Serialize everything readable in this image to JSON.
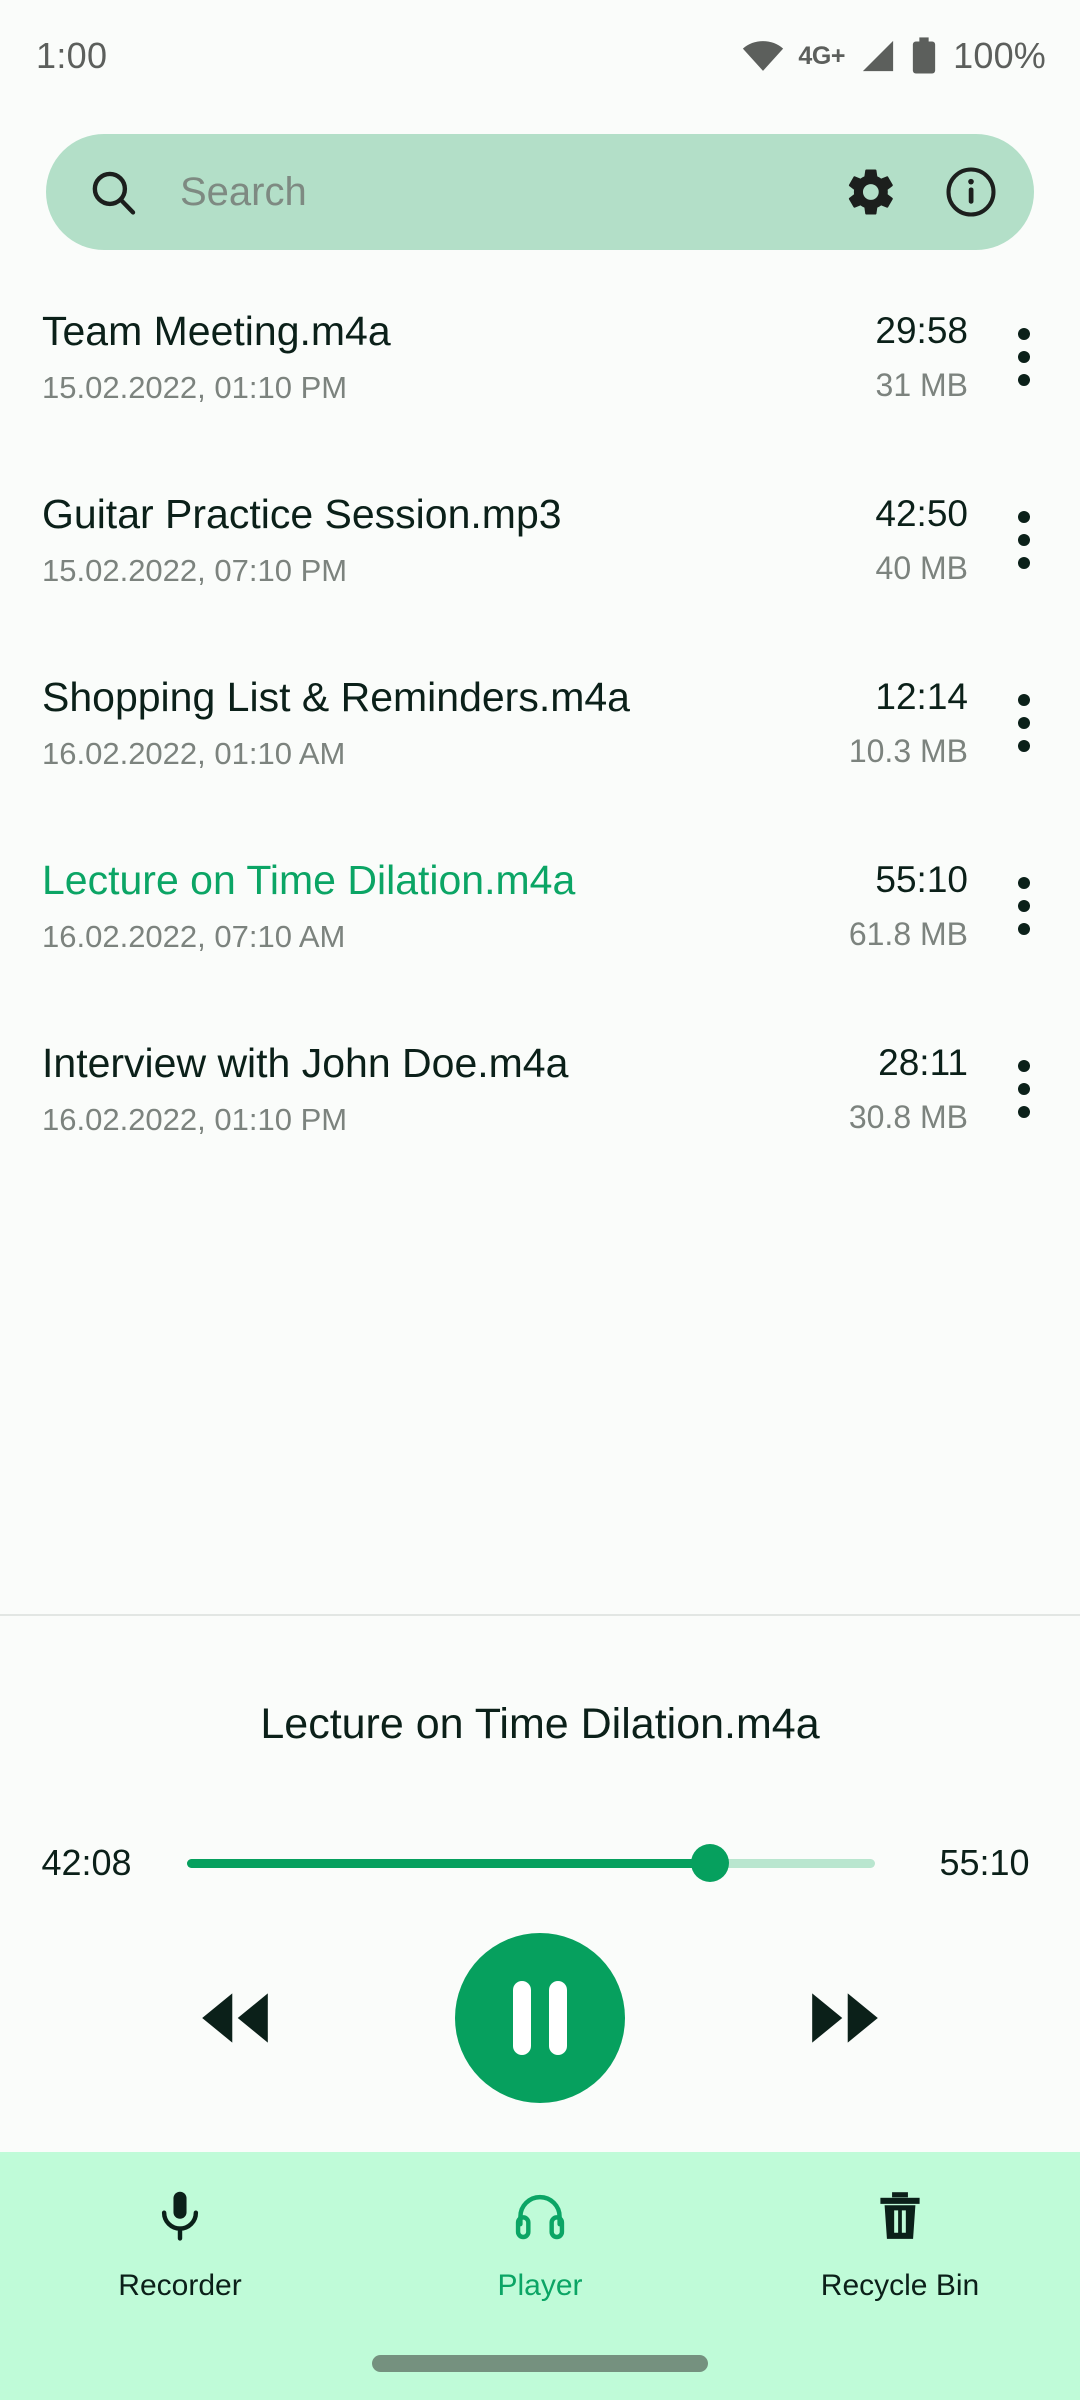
{
  "status_bar": {
    "time": "1:00",
    "network_label": "4G+",
    "battery_percent": "100%",
    "wifi_icon": "wifi-icon",
    "signal_icon": "cellular-signal-icon",
    "battery_icon": "battery-full-icon"
  },
  "search": {
    "placeholder": "Search",
    "search_icon": "search-icon",
    "settings_icon": "gear-icon",
    "info_icon": "info-circle-icon"
  },
  "recordings": [
    {
      "title": "Team Meeting.m4a",
      "date": "15.02.2022, 01:10 PM",
      "duration": "29:58",
      "size": "31 MB",
      "active": false
    },
    {
      "title": "Guitar Practice Session.mp3",
      "date": "15.02.2022, 07:10 PM",
      "duration": "42:50",
      "size": "40 MB",
      "active": false
    },
    {
      "title": "Shopping List & Reminders.m4a",
      "date": "16.02.2022, 01:10 AM",
      "duration": "12:14",
      "size": "10.3 MB",
      "active": false
    },
    {
      "title": "Lecture on Time Dilation.m4a",
      "date": "16.02.2022, 07:10 AM",
      "duration": "55:10",
      "size": "61.8 MB",
      "active": true
    },
    {
      "title": "Interview with John Doe.m4a",
      "date": "16.02.2022, 01:10 PM",
      "duration": "28:11",
      "size": "30.8 MB",
      "active": false
    }
  ],
  "player": {
    "title": "Lecture on Time Dilation.m4a",
    "current_time": "42:08",
    "total_time": "55:10",
    "progress_percent": 76,
    "rewind_icon": "rewind-icon",
    "play_pause_icon": "pause-icon",
    "forward_icon": "fast-forward-icon"
  },
  "bottom_nav": {
    "items": [
      {
        "label": "Recorder",
        "icon": "microphone-icon",
        "active": false
      },
      {
        "label": "Player",
        "icon": "headphones-icon",
        "active": true
      },
      {
        "label": "Recycle Bin",
        "icon": "trash-icon",
        "active": false
      }
    ]
  },
  "colors": {
    "accent": "#06A05E",
    "accent_text": "#0BA565",
    "search_bg": "#B3DFC8",
    "nav_bg": "#BFFBD8",
    "page_bg": "#FAFCFA",
    "primary_text": "#0B2019",
    "secondary_text": "#7C837E"
  }
}
